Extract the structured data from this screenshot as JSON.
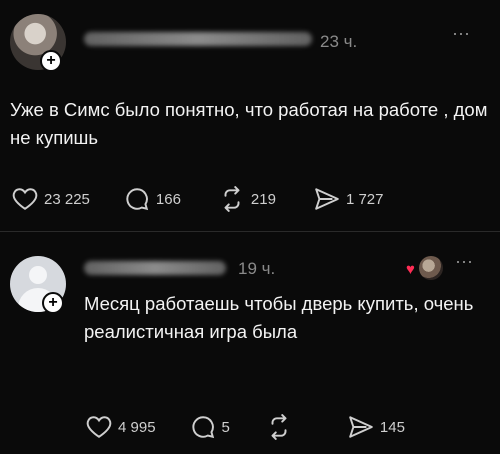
{
  "posts": [
    {
      "time": "23 ч.",
      "username": "katerinashpigarevich",
      "text": "Уже в Симс было понятно, что работая на работе , дом не купишь",
      "likes": "23 225",
      "comments": "166",
      "reposts": "219",
      "shares": "1 727"
    },
    {
      "time": "19 ч.",
      "username": "georgin2024",
      "text": "Месяц работаешь чтобы дверь купить, очень реалистичная игра была",
      "likes": "4 995",
      "comments": "5",
      "reposts": "",
      "shares": "145"
    }
  ],
  "ui": {
    "more": "⋯",
    "plus": "+"
  },
  "icons": [
    "heart-icon",
    "comment-icon",
    "repost-icon",
    "share-icon"
  ],
  "colors": {
    "background": "#0a0a0a",
    "text": "#f3f3f3",
    "muted": "#8a8a8a",
    "liked": "#ff2d55"
  }
}
